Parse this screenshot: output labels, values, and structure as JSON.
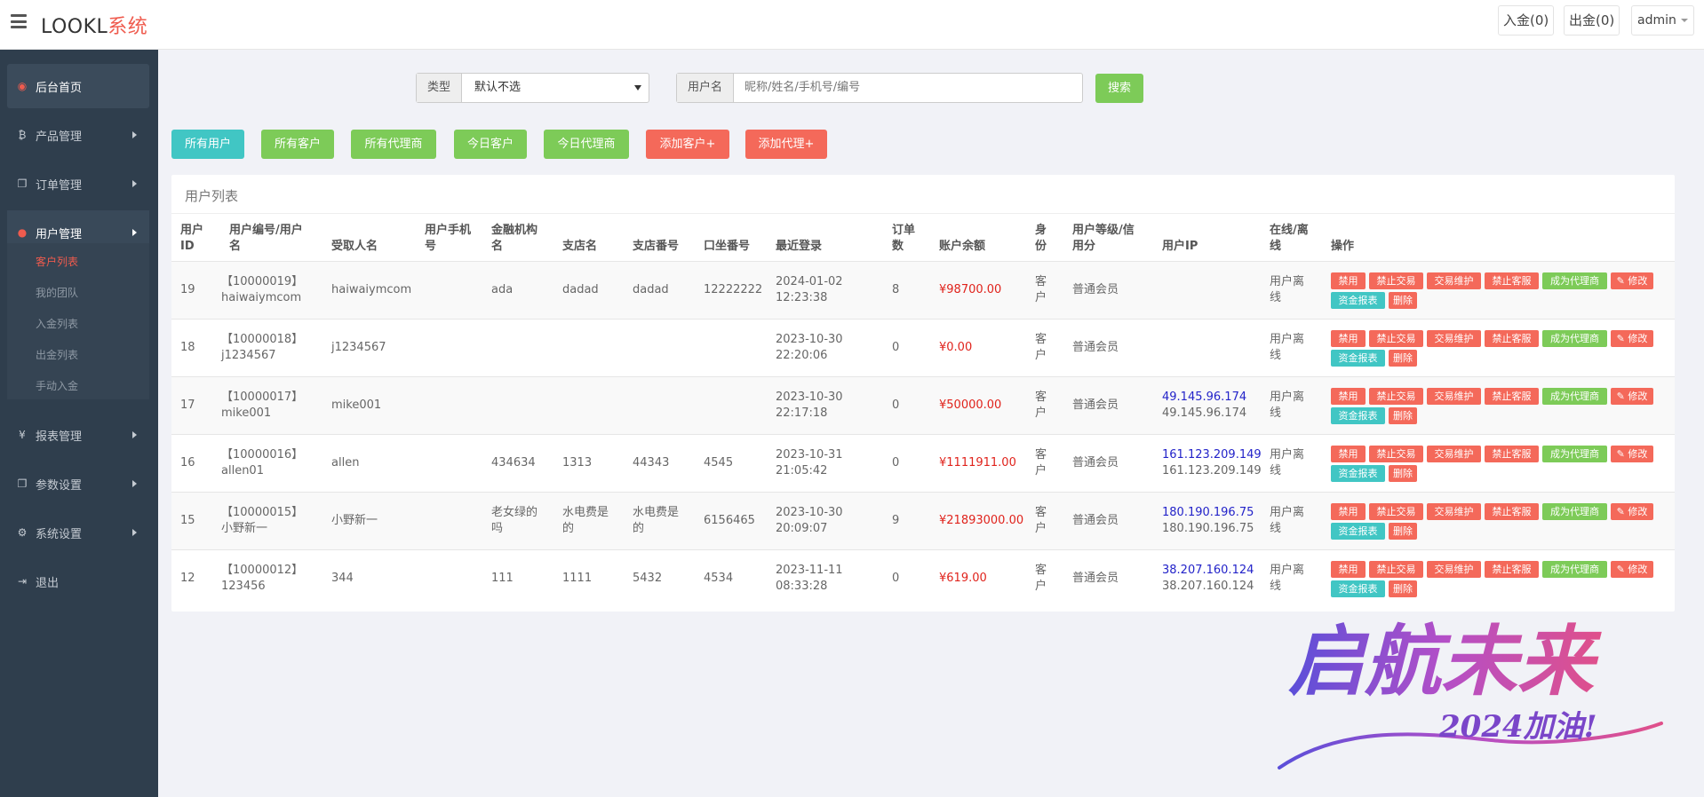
{
  "header": {
    "logo_main": "LOOKL",
    "logo_accent": "系统",
    "deposit_label": "入金(0)",
    "withdraw_label": "出金(0)",
    "user_label": "admin"
  },
  "sidebar": {
    "items": [
      {
        "label": "后台首页",
        "icon": "dashboard-icon"
      },
      {
        "label": "产品管理",
        "icon": "bitcoin-icon"
      },
      {
        "label": "订单管理",
        "icon": "copy-icon"
      },
      {
        "label": "用户管理",
        "icon": "user-icon"
      },
      {
        "label": "报表管理",
        "icon": "yen-icon"
      },
      {
        "label": "参数设置",
        "icon": "copy-icon"
      },
      {
        "label": "系统设置",
        "icon": "gears-icon"
      },
      {
        "label": "退出",
        "icon": "sign-out-icon"
      }
    ],
    "submenu": [
      "客户列表",
      "我的团队",
      "入金列表",
      "出金列表",
      "手动入金"
    ]
  },
  "filters": {
    "type_label": "类型",
    "type_value": "默认不选",
    "username_label": "用户名",
    "username_placeholder": "昵称/姓名/手机号/编号",
    "search_label": "搜索"
  },
  "actions": [
    "所有用户",
    "所有客户",
    "所有代理商",
    "今日客户",
    "今日代理商",
    "添加客户+",
    "添加代理+"
  ],
  "panel_title": "用户列表",
  "table": {
    "headers": {
      "id": [
        "用户",
        "ID"
      ],
      "code": [
        "用户编号/用户",
        "名"
      ],
      "receiver": [
        "受取人名"
      ],
      "phone": [
        "用户手机",
        "号"
      ],
      "bank": [
        "金融机构",
        "名"
      ],
      "branch": [
        "支店名"
      ],
      "branch_no": [
        "支店番号"
      ],
      "account_no": [
        "口坐番号"
      ],
      "last_login": [
        "最近登录"
      ],
      "orders": [
        "订单",
        "数"
      ],
      "balance": [
        "账户余额"
      ],
      "identity": [
        "身",
        "份"
      ],
      "level": [
        "用户等级/信",
        "用分"
      ],
      "ip": [
        "用户IP"
      ],
      "online": [
        "在线/离",
        "线"
      ],
      "ops": [
        "操作"
      ]
    },
    "ops": [
      "禁用",
      "禁止交易",
      "交易维护",
      "禁止客服",
      "成为代理商",
      "✎ 修改",
      "资金报表",
      "删除"
    ],
    "rows": [
      {
        "id": "19",
        "code": [
          "【10000019】",
          "haiwaiymcom"
        ],
        "receiver": "haiwaiymcom",
        "phone": "",
        "bank": [
          "ada"
        ],
        "branch": [
          "dadad"
        ],
        "branch_no": [
          "dadad"
        ],
        "account_no": "12222222",
        "last_login": [
          "2024-01-02",
          "12:23:38"
        ],
        "orders": "8",
        "balance": "¥98700.00",
        "identity": [
          "客",
          "户"
        ],
        "level": "普通会员",
        "ip": [
          "",
          ""
        ],
        "online": [
          "用户离",
          "线"
        ]
      },
      {
        "id": "18",
        "code": [
          "【10000018】",
          "j1234567"
        ],
        "receiver": "j1234567",
        "phone": "",
        "bank": [
          ""
        ],
        "branch": [
          ""
        ],
        "branch_no": [
          ""
        ],
        "account_no": "",
        "last_login": [
          "2023-10-30",
          "22:20:06"
        ],
        "orders": "0",
        "balance": "¥0.00",
        "identity": [
          "客",
          "户"
        ],
        "level": "普通会员",
        "ip": [
          "",
          ""
        ],
        "online": [
          "用户离",
          "线"
        ]
      },
      {
        "id": "17",
        "code": [
          "【10000017】",
          "mike001"
        ],
        "receiver": "mike001",
        "phone": "",
        "bank": [
          ""
        ],
        "branch": [
          ""
        ],
        "branch_no": [
          ""
        ],
        "account_no": "",
        "last_login": [
          "2023-10-30",
          "22:17:18"
        ],
        "orders": "0",
        "balance": "¥50000.00",
        "identity": [
          "客",
          "户"
        ],
        "level": "普通会员",
        "ip": [
          "49.145.96.174",
          "49.145.96.174"
        ],
        "online": [
          "用户离",
          "线"
        ]
      },
      {
        "id": "16",
        "code": [
          "【10000016】",
          "allen01"
        ],
        "receiver": "allen",
        "phone": "",
        "bank": [
          "434634"
        ],
        "branch": [
          "1313"
        ],
        "branch_no": [
          "44343"
        ],
        "account_no": "4545",
        "last_login": [
          "2023-10-31",
          "21:05:42"
        ],
        "orders": "0",
        "balance": "¥1111911.00",
        "identity": [
          "客",
          "户"
        ],
        "level": "普通会员",
        "ip": [
          "161.123.209.149",
          "161.123.209.149"
        ],
        "online": [
          "用户离",
          "线"
        ]
      },
      {
        "id": "15",
        "code": [
          "【10000015】",
          "小野新一"
        ],
        "receiver": "小野新一",
        "phone": "",
        "bank": [
          "老女绿的",
          "吗"
        ],
        "branch": [
          "水电费是",
          "的"
        ],
        "branch_no": [
          "水电费是",
          "的"
        ],
        "account_no": "6156465",
        "last_login": [
          "2023-10-30",
          "20:09:07"
        ],
        "orders": "9",
        "balance": "¥21893000.00",
        "identity": [
          "客",
          "户"
        ],
        "level": "普通会员",
        "ip": [
          "180.190.196.75",
          "180.190.196.75"
        ],
        "online": [
          "用户离",
          "线"
        ]
      },
      {
        "id": "12",
        "code": [
          "【10000012】",
          "123456"
        ],
        "receiver": "344",
        "phone": "",
        "bank": [
          "111"
        ],
        "branch": [
          "1111"
        ],
        "branch_no": [
          "5432"
        ],
        "account_no": "4534",
        "last_login": [
          "2023-11-11",
          "08:33:28"
        ],
        "orders": "0",
        "balance": "¥619.00",
        "identity": [
          "客",
          "户"
        ],
        "level": "普通会员",
        "ip": [
          "38.207.160.124",
          "38.207.160.124"
        ],
        "online": [
          "用户离",
          "线"
        ]
      }
    ]
  },
  "watermark": {
    "main": "启航未来",
    "sub": "2024加油!"
  },
  "colors": {
    "accent_red": "#ef5b4e",
    "sidebar_bg": "#2f3e4d",
    "teal": "#41c6c4",
    "green": "#7dcb58",
    "red": "#f4695a",
    "money_red": "#e0231c",
    "ip_blue": "#2323c9"
  }
}
